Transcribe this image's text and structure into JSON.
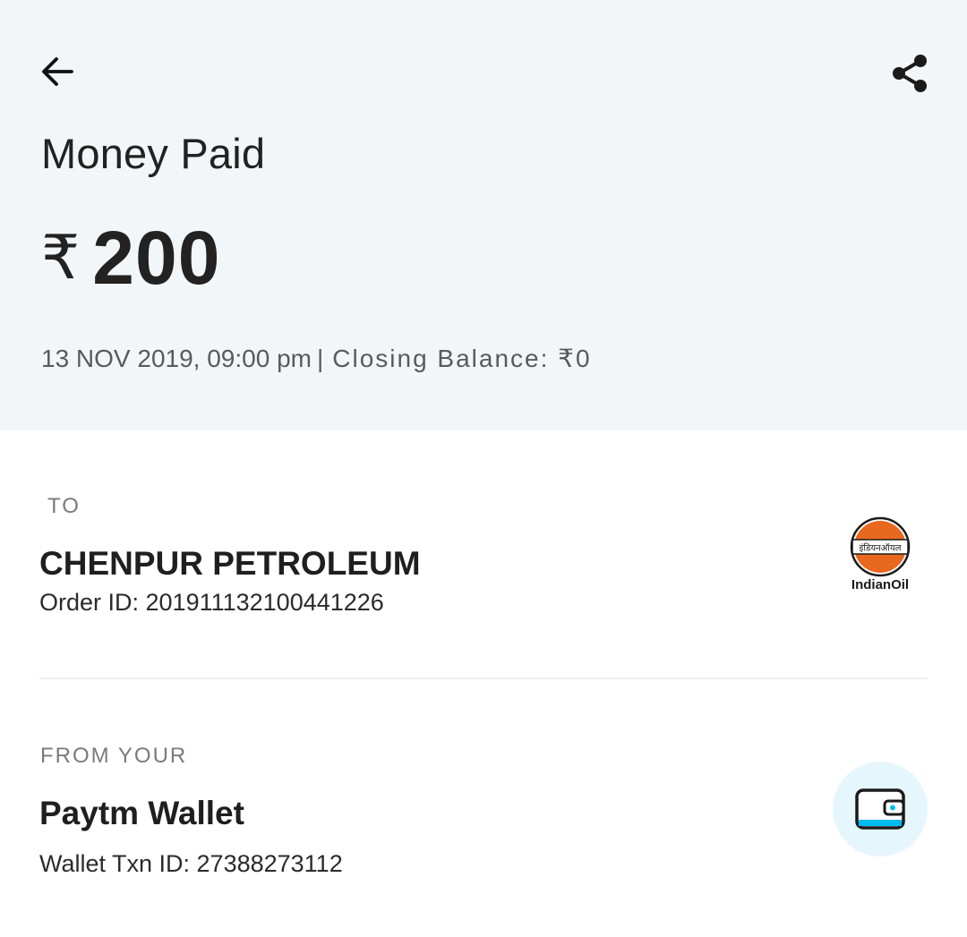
{
  "header": {
    "title": "Money Paid",
    "currency_symbol": "₹",
    "amount": "200",
    "datetime": "13 NOV 2019, 09:00 pm",
    "separator": "|",
    "closing_balance": "Closing Balance: ₹0",
    "back_icon": "arrow-left-icon",
    "share_icon": "share-icon",
    "background_color": "#f3f6f8"
  },
  "to": {
    "label": "TO",
    "name": "CHENPUR PETROLEUM",
    "order_id": "Order ID: 201911132100441226",
    "logo_text": "IndianOil",
    "logo_hindi_text": "इंडियनऑयल",
    "logo_color": "#e8681f"
  },
  "from": {
    "label": "FROM YOUR",
    "name": "Paytm Wallet",
    "txn_id": "Wallet Txn ID: 27388273112",
    "icon": "wallet-icon",
    "icon_bg_color": "#e6f6fd",
    "icon_accent_color": "#00baf2"
  }
}
